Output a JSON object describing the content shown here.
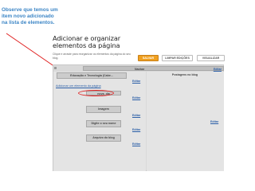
{
  "annotation": {
    "lines": [
      "Observe que temos um",
      "item novo adicionado",
      "na lista de elementos."
    ]
  },
  "page": {
    "title": "Adicionar e organizar elementos da página",
    "subtitle": "Clique e arraste para reorganizar os elementos da página do seu",
    "subtitle2": "blog."
  },
  "toolbar": {
    "save_label": "SALVAR",
    "clear_label": "LIMPAR EDIÇÕES",
    "view_label": "VISUALIZAR"
  },
  "layout_elements": {
    "header_label": "Navbar",
    "edit_label": "Editar",
    "left_column": {
      "add_gadget_label": "Adicionar um elemento da página",
      "widgets": [
        {
          "title": "Educação e Tecnologia (Cabe...",
          "edit": "Editar"
        },
        {
          "title": "nova_dia",
          "edit": "Editar"
        },
        {
          "title": "Imagem",
          "edit": "Editar"
        },
        {
          "title": "Digite o seu nome",
          "edit": "Editar"
        },
        {
          "title": "Arquivo do blog",
          "edit": "Editar"
        }
      ]
    },
    "right_column": {
      "widgets": [
        {
          "title": "Postagens no blog",
          "edit": "Editar"
        }
      ]
    }
  },
  "colors": {
    "callout_text": "#3d86c6",
    "arrow": "#e02020",
    "save_button": "#f0a020",
    "link": "#2b5fa8"
  }
}
